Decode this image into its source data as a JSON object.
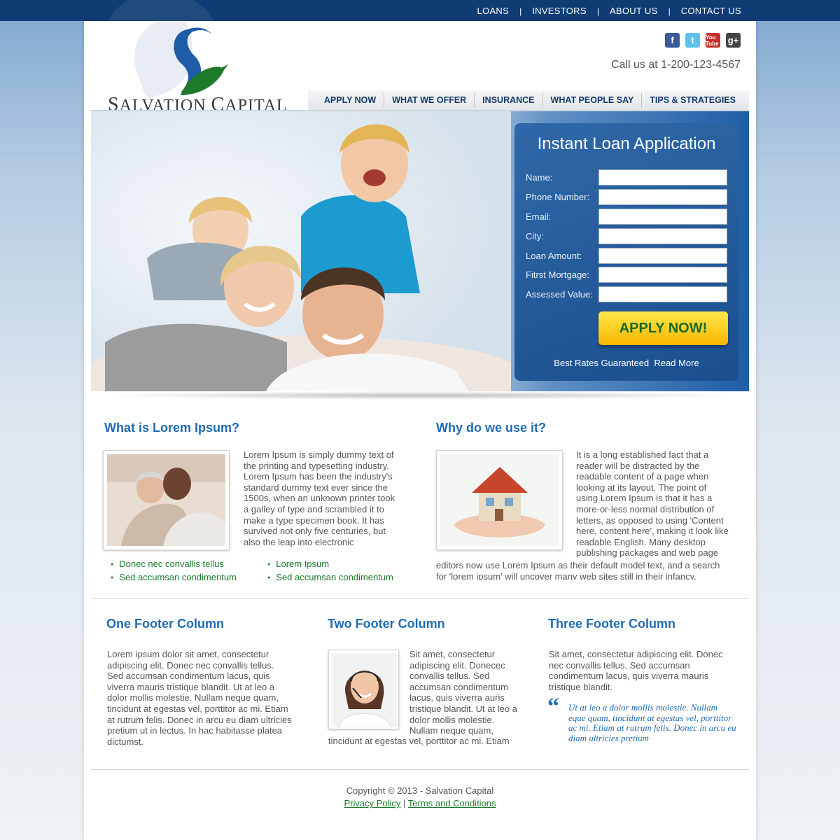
{
  "top_nav": {
    "items": [
      "LOANS",
      "INVESTORS",
      "ABOUT US",
      "CONTACT US"
    ],
    "separator": "|"
  },
  "brand": {
    "name_part1": "S",
    "name_part2": "ALVATION ",
    "name_part3": "C",
    "name_part4": "APITAL"
  },
  "social": [
    "facebook-icon",
    "twitter-icon",
    "youtube-icon",
    "google-plus-icon"
  ],
  "social_glyphs": {
    "facebook": "f",
    "twitter": "t",
    "youtube": "You Tube",
    "google": "g+"
  },
  "call_us": "Call us at 1-200-123-4567",
  "main_nav": [
    "APPLY NOW",
    "WHAT WE OFFER",
    "INSURANCE",
    "WHAT PEOPLE SAY",
    "TIPS & STRATEGIES"
  ],
  "loan_form": {
    "title": "Instant Loan Application",
    "fields": [
      "Name:",
      "Phone Number:",
      "Email:",
      "City:",
      "Loan Amount:",
      "Fitrst Mortgage:",
      "Assessed Value:"
    ],
    "submit": "APPLY NOW!",
    "footer_text": "Best Rates Guaranteed",
    "read_more": "Read More"
  },
  "section1": {
    "heading": "What is Lorem Ipsum?",
    "body": "Lorem Ipsum is simply dummy text of the printing and typesetting industry. Lorem Ipsum has been the industry's standard dummy text ever since the 1500s, when an unknown printer took a galley of type and scrambled it to make a type specimen book. It has survived not only five centuries, but also the leap into electronic",
    "bullets_left": [
      "Donec nec convallis tellus",
      "Sed accumsan condimentum"
    ],
    "bullets_right": [
      "Lorem Ipsum",
      "Sed accumsan condimentum"
    ]
  },
  "section2": {
    "heading": "Why do we use it?",
    "body": "It is a long established fact that a reader will be distracted by the readable content of a page when looking at its layout. The point of using Lorem Ipsum is that it has a more-or-less normal distribution of letters, as opposed to using 'Content here, content here', making it look like readable English. Many desktop publishing packages and web page",
    "body_cont": "editors now use Lorem Ipsum as their default model text, and a search for 'lorem ipsum' will uncover many web sites still in their infancy."
  },
  "footer": {
    "col1": {
      "heading": "One Footer Column",
      "body": "Lorem ipsum dolor sit amet, consectetur adipiscing elit. Donec nec convallis tellus. Sed accumsan condimentum lacus, quis viverra mauris tristique blandit. Ut at leo a dolor mollis molestie. Nullam neque quam, tincidunt at egestas vel, porttitor ac mi. Etiam at rutrum felis. Donec in arcu eu diam ultricies pretium ut in lectus. In hac habitasse platea dictumst."
    },
    "col2": {
      "heading": "Two Footer Column",
      "body": "Sit amet, consectetur adipiscing elit. Donecec convallis tellus. Sed accumsan condimentum lacus, quis viverra auris tristique blandit. Ut at leo a dolor mollis molestie. Nullam neque quam,",
      "body_cont": "tincidunt at egestas vel, porttitor ac mi. Etiam"
    },
    "col3": {
      "heading": "Three Footer Column",
      "body": "Sit amet, consectetur adipiscing elit. Donec nec convallis tellus. Sed accumsan condimentum lacus, quis viverra mauris tristique blandit.",
      "quote_mark": "“",
      "quote": "Ut at leo a dolor mollis molestie. Nullam eque quam, tincidunt at egestas vel, porttitor ac mi. Etiam at rutrum felis. Donec in arcu eu diam ultricies pretium"
    }
  },
  "copyright": "Copyright © 2013 - Salvation Capital",
  "footer_links": {
    "privacy": "Privacy Policy",
    "separator": "|",
    "terms": "Terms and Conditions"
  },
  "colors": {
    "navy": "#0f3c74",
    "accent_blue": "#1f6bb5",
    "green": "#1d7a2a",
    "button_yellow": "#f7b500"
  }
}
